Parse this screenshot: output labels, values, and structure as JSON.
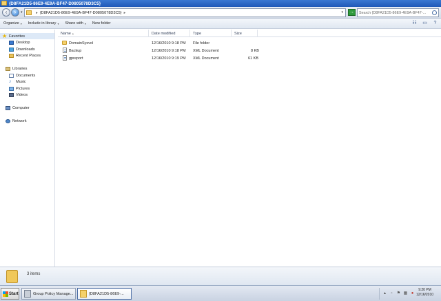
{
  "window": {
    "title": "{D8FA21D5-86E9-4E9A-BF47-D0805078D3C5}"
  },
  "address": {
    "path_segment": "{D8FA21D5-86E9-4E9A-BF47-D0805078D3C5}",
    "search_placeholder": "Search {D8FA21D5-86E9-4E9A-BF47-..."
  },
  "toolbar": {
    "organize": "Organize",
    "include_in_library": "Include in library",
    "share_with": "Share with",
    "new_folder": "New folder"
  },
  "nav": {
    "favorites": "Favorites",
    "desktop": "Desktop",
    "downloads": "Downloads",
    "recent_places": "Recent Places",
    "libraries": "Libraries",
    "documents": "Documents",
    "music": "Music",
    "pictures": "Pictures",
    "videos": "Videos",
    "computer": "Computer",
    "network": "Network"
  },
  "columns": {
    "name": "Name",
    "date_modified": "Date modified",
    "type": "Type",
    "size": "Size"
  },
  "files": [
    {
      "name": "DomainSysvol",
      "date": "12/16/2010 9:18 PM",
      "type": "File folder",
      "size": "",
      "icon": "folder-icon"
    },
    {
      "name": "Backup",
      "date": "12/16/2010 9:18 PM",
      "type": "XML Document",
      "size": "8 KB",
      "icon": "xml-file-icon"
    },
    {
      "name": "gpreport",
      "date": "12/16/2010 9:19 PM",
      "type": "XML Document",
      "size": "61 KB",
      "icon": "xml-file-icon"
    }
  ],
  "details": {
    "item_count": "3 items"
  },
  "taskbar": {
    "start": "Start",
    "task1": "Group Policy Manage...",
    "task2": "{D8FA21D5-86E9-...",
    "time": "9:20 PM",
    "date": "12/16/2010"
  },
  "colors": {
    "titlebar": "#2a66c6",
    "folder": "#f5d16b",
    "selection": "#dde9f7"
  }
}
